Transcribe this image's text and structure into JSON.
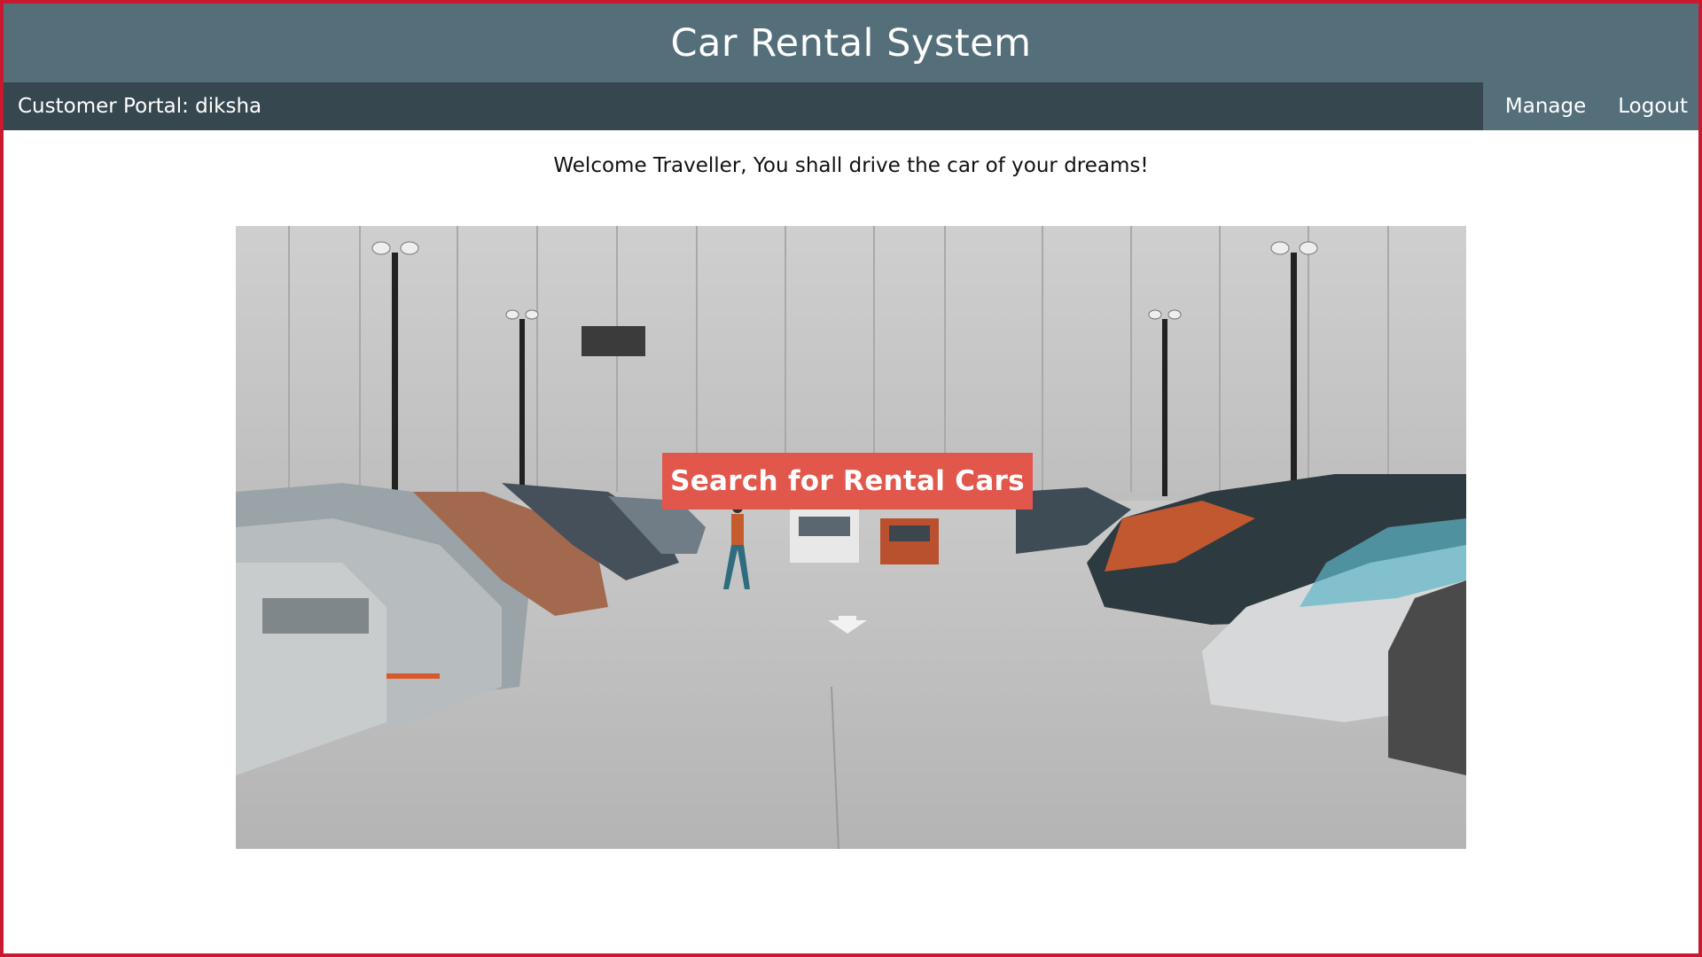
{
  "header": {
    "title": "Car Rental System"
  },
  "navbar": {
    "portal_label": "Customer Portal: diksha",
    "links": [
      {
        "label": "Manage"
      },
      {
        "label": "Logout"
      }
    ]
  },
  "main": {
    "welcome_text": "Welcome Traveller, You shall drive the car of your dreams!",
    "hero": {
      "image_subject": "parking-lot-with-cars",
      "cta_label": "Search for Rental Cars"
    }
  },
  "colors": {
    "frame_border": "#c8192e",
    "header_bg": "#546e7a",
    "navbar_bg": "#37474f",
    "cta_bg": "#e2574c"
  }
}
